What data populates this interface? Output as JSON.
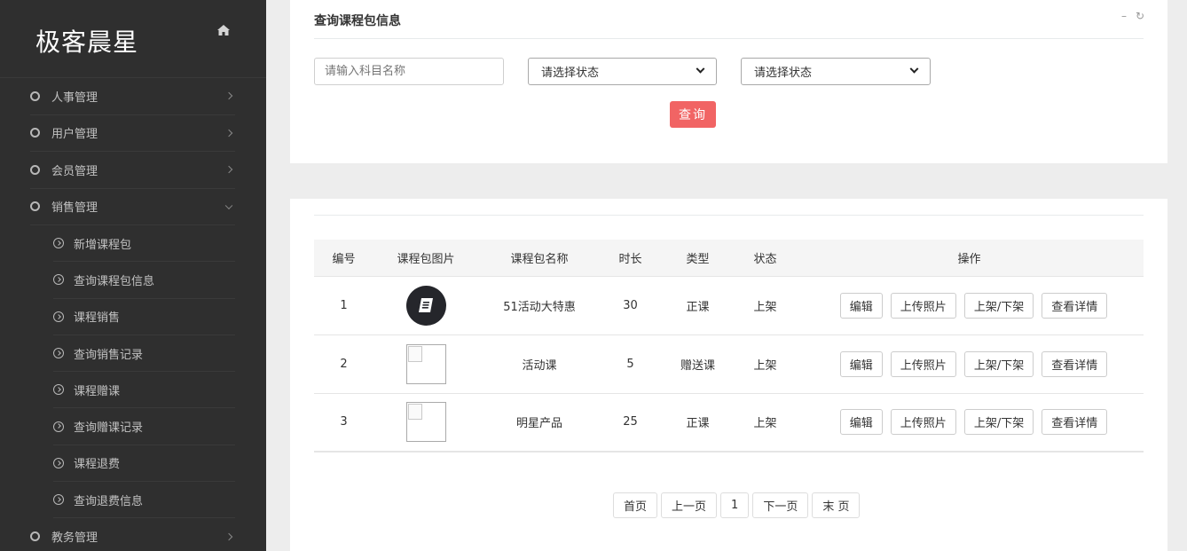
{
  "app": {
    "logo": "极客晨星"
  },
  "sidebar": {
    "items": [
      {
        "label": "人事管理"
      },
      {
        "label": "用户管理"
      },
      {
        "label": "会员管理"
      },
      {
        "label": "销售管理"
      }
    ],
    "sub_items": [
      {
        "label": "新增课程包"
      },
      {
        "label": "查询课程包信息"
      },
      {
        "label": "课程销售"
      },
      {
        "label": "查询销售记录"
      },
      {
        "label": "课程赠课"
      },
      {
        "label": "查询赠课记录"
      },
      {
        "label": "课程退费"
      },
      {
        "label": "查询退费信息"
      }
    ],
    "next_item": {
      "label": "教务管理"
    }
  },
  "search": {
    "title": "查询课程包信息",
    "collapse_icon": "–",
    "refresh_icon": "↻",
    "name_placeholder": "请输入科目名称",
    "select1_value": "请选择状态",
    "select2_value": "请选择状态",
    "query_label": "查询"
  },
  "table": {
    "headers": [
      "编号",
      "课程包图片",
      "课程包名称",
      "时长",
      "类型",
      "状态",
      "操作"
    ],
    "rows": [
      {
        "id": "1",
        "name": "51活动大特惠",
        "duration": "30",
        "type": "正课",
        "status": "上架"
      },
      {
        "id": "2",
        "name": "活动课",
        "duration": "5",
        "type": "赠送课",
        "status": "上架"
      },
      {
        "id": "3",
        "name": "明星产品",
        "duration": "25",
        "type": "正课",
        "status": "上架"
      }
    ],
    "actions": {
      "edit": "编辑",
      "upload": "上传照片",
      "toggle": "上架/下架",
      "detail": "查看详情"
    }
  },
  "pager": {
    "first": "首页",
    "prev": "上一页",
    "current": "1",
    "next": "下一页",
    "last": "末 页"
  }
}
